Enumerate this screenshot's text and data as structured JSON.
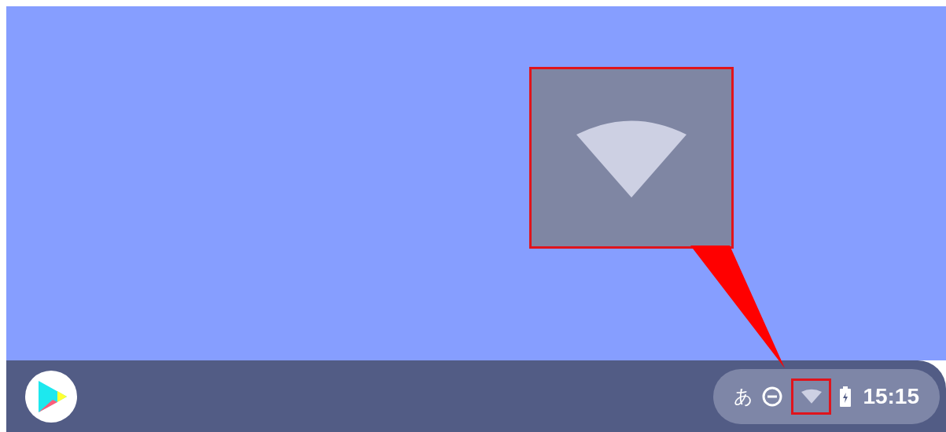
{
  "tray": {
    "ime": "あ",
    "time": "15:15"
  }
}
